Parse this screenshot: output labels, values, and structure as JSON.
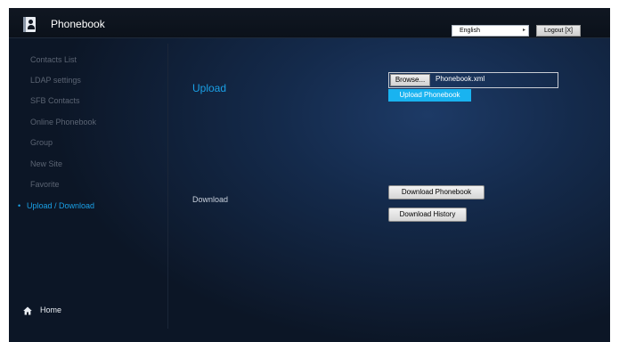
{
  "header": {
    "app_title": "Phonebook",
    "language_selected": "English",
    "logout_label": "Logout [X]"
  },
  "sidebar": {
    "items": [
      {
        "label": "Contacts List"
      },
      {
        "label": "LDAP settings"
      },
      {
        "label": "SFB Contacts"
      },
      {
        "label": "Online Phonebook"
      },
      {
        "label": "Group"
      },
      {
        "label": "New Site"
      },
      {
        "label": "Favorite"
      },
      {
        "label": "Upload / Download"
      }
    ],
    "active_index": 7,
    "home_label": "Home"
  },
  "main": {
    "upload_label": "Upload",
    "browse_label": "Browse...",
    "file_name": "Phonebook.xml",
    "upload_button": "Upload Phonebook",
    "download_label": "Download",
    "download_phonebook_button": "Download Phonebook",
    "download_history_button": "Download History"
  },
  "colors": {
    "accent": "#1aa0e6",
    "upload_button_bg": "#19b3f0",
    "background_dark": "#0c1626"
  },
  "icons": [
    "phonebook-icon",
    "home-icon",
    "dropdown-caret-icon"
  ]
}
